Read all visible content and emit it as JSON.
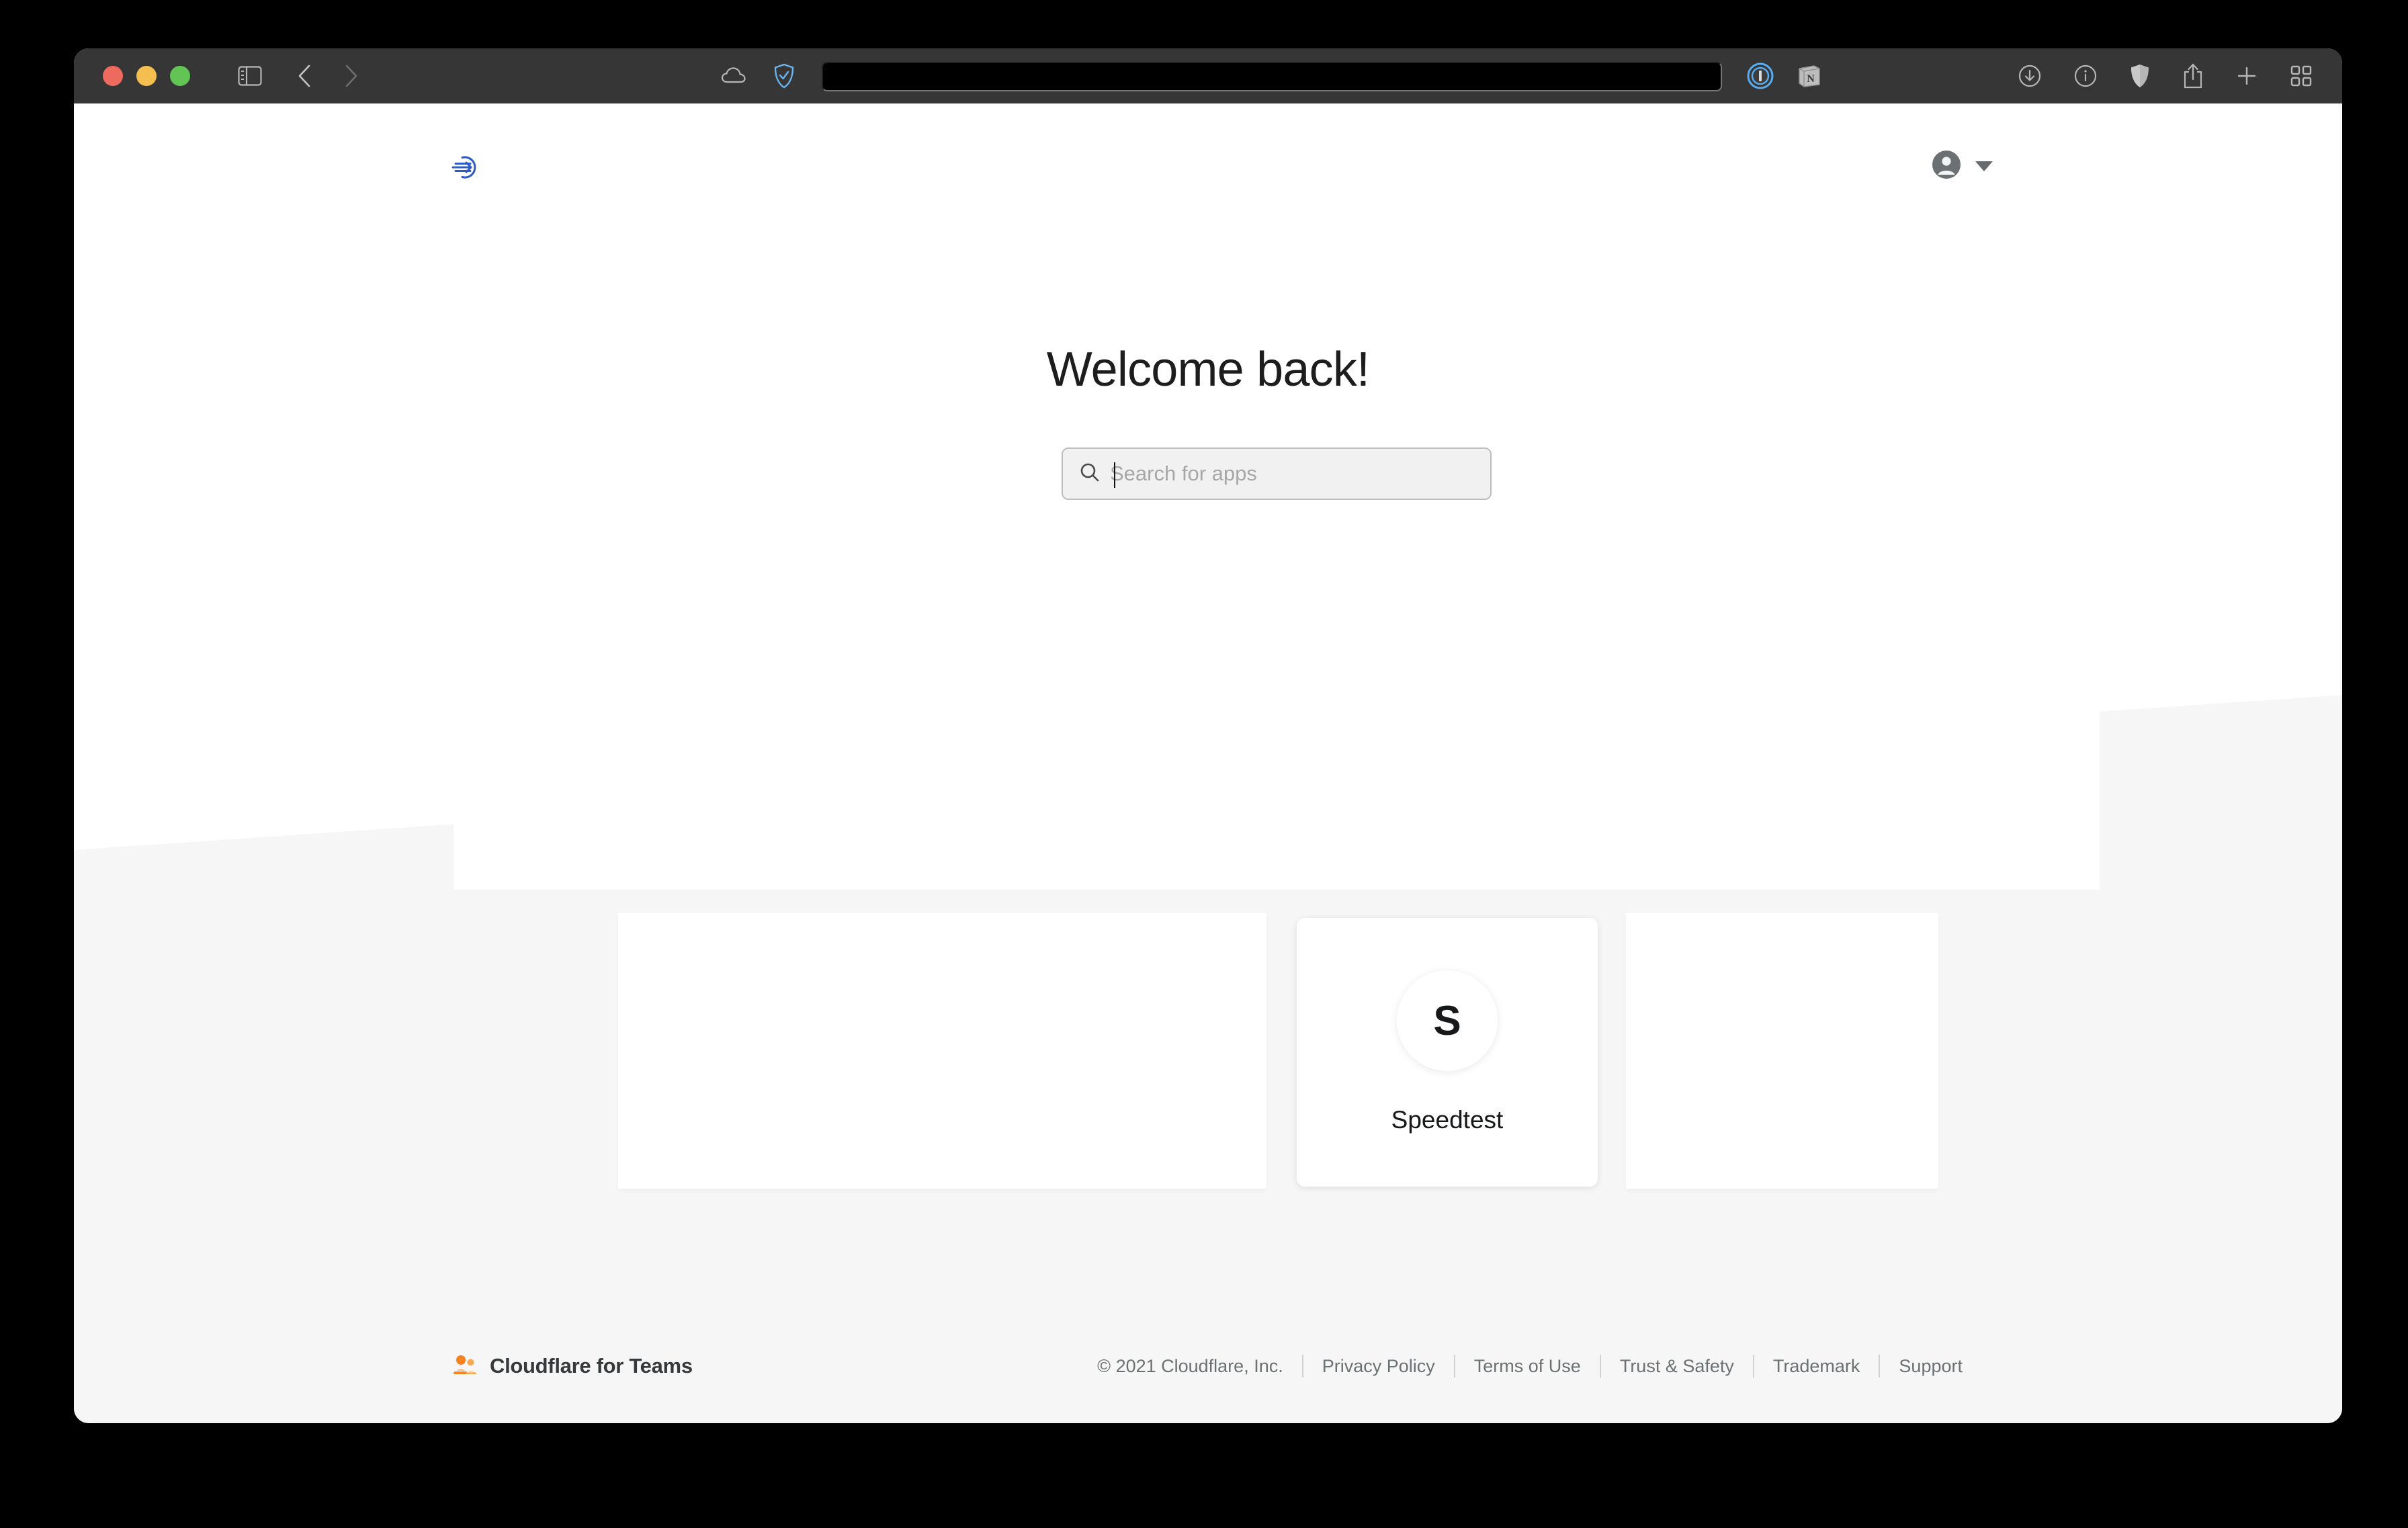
{
  "browser": {
    "traffic_lights": [
      "close",
      "minimize",
      "maximize"
    ],
    "toolbar_icons": [
      "sidebar-icon",
      "back-icon",
      "forward-icon",
      "cloud-icon",
      "shield-check-icon",
      "1password-icon",
      "notion-icon",
      "downloads-icon",
      "reader-info-icon",
      "privacy-shield-icon",
      "share-icon",
      "new-tab-icon",
      "tab-overview-icon"
    ],
    "address_bar_value": "",
    "address_bar_placeholder": ""
  },
  "page": {
    "logo_name": "cloudflare-access-logo",
    "title": "Welcome back!",
    "account": {
      "avatar_icon": "user-avatar-icon",
      "caret_icon": "chevron-down-icon"
    },
    "search": {
      "placeholder": "Search for apps",
      "value": "",
      "icon": "search-icon"
    },
    "apps": [
      {
        "name": "Speedtest",
        "initial": "S"
      }
    ]
  },
  "footer": {
    "brand": "Cloudflare for Teams",
    "brand_icon": "teams-people-icon",
    "copyright": "© 2021 Cloudflare, Inc.",
    "links": [
      "Privacy Policy",
      "Terms of Use",
      "Trust & Safety",
      "Trademark",
      "Support"
    ]
  },
  "colors": {
    "toolbar_bg": "#363636",
    "page_bg": "#f6f6f6",
    "hero_bg": "#ffffff",
    "accent_blue": "#2c5cc5",
    "brand_orange": "#f6821f",
    "text_dark": "#1d1d1d",
    "text_muted": "#6b7073"
  }
}
